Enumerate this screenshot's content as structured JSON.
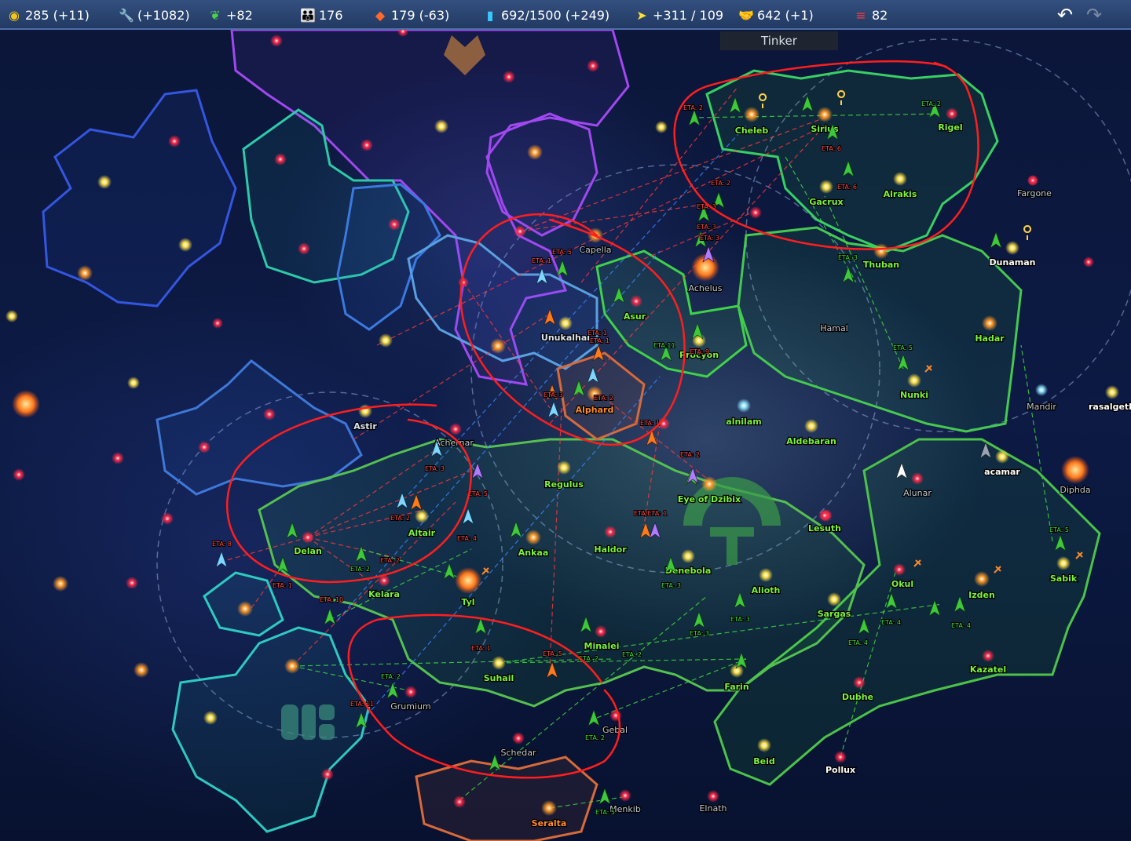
{
  "resources": [
    {
      "id": "credits",
      "icon": "credits-coin-icon",
      "label": "285 (+11)",
      "color": "#f5c518"
    },
    {
      "id": "industry",
      "icon": "wrench-icon",
      "label": "(+1082)",
      "color": "#ff8a1f"
    },
    {
      "id": "food",
      "icon": "wheat-icon",
      "label": "+82",
      "color": "#4cd24c"
    },
    {
      "id": "population",
      "icon": "people-icon",
      "label": "176",
      "color": "#ffffff"
    },
    {
      "id": "materials",
      "icon": "ore-icon",
      "label": "179 (-63)",
      "color": "#ff6a2a"
    },
    {
      "id": "research",
      "icon": "test-tube-icon",
      "label": "692/1500 (+249)",
      "color": "#37c8ff"
    },
    {
      "id": "fleet",
      "icon": "ship-icon",
      "label": "+311 / 109",
      "color": "#ffe033"
    },
    {
      "id": "diplomacy",
      "icon": "handshake-icon",
      "label": "642 (+1)",
      "color": "#b99cff"
    },
    {
      "id": "military",
      "icon": "flag-icon",
      "label": "82",
      "color": "#ff3b3b"
    }
  ],
  "tooltip": "Tinker",
  "colors": {
    "player": "#7cf23a",
    "enemy": "#ff8a2a",
    "annotation": "#ff2020",
    "neutral": "#dde6f2"
  },
  "systems": [
    {
      "name": "Cheleb",
      "owner": "player"
    },
    {
      "name": "Sirius",
      "owner": "player"
    },
    {
      "name": "Rigel",
      "owner": "player"
    },
    {
      "name": "Gacrux",
      "owner": "player"
    },
    {
      "name": "Alrakis",
      "owner": "player"
    },
    {
      "name": "Fargone",
      "owner": "neutral"
    },
    {
      "name": "Capella",
      "owner": "neutral"
    },
    {
      "name": "Achelus",
      "owner": "neutral"
    },
    {
      "name": "Thuban",
      "owner": "player"
    },
    {
      "name": "Dunaman",
      "owner": "white"
    },
    {
      "name": "Unukalhai",
      "owner": "neutral"
    },
    {
      "name": "Asur",
      "owner": "player"
    },
    {
      "name": "Hamal",
      "owner": "neutral"
    },
    {
      "name": "Procyon",
      "owner": "player"
    },
    {
      "name": "Hadar",
      "owner": "player"
    },
    {
      "name": "Nunki",
      "owner": "player"
    },
    {
      "name": "Alphard",
      "owner": "enemy"
    },
    {
      "name": "alnilam",
      "owner": "player"
    },
    {
      "name": "Aldebaran",
      "owner": "player"
    },
    {
      "name": "Mandir",
      "owner": "neutral"
    },
    {
      "name": "rasalgethi",
      "owner": "white"
    },
    {
      "name": "Astir",
      "owner": "neutral"
    },
    {
      "name": "Achernar",
      "owner": "neutral"
    },
    {
      "name": "Regulus",
      "owner": "player"
    },
    {
      "name": "Eye of Dzibix",
      "owner": "player"
    },
    {
      "name": "acamar",
      "owner": "white"
    },
    {
      "name": "Alunar",
      "owner": "neutral"
    },
    {
      "name": "Diphda",
      "owner": "neutral"
    },
    {
      "name": "Altair",
      "owner": "player"
    },
    {
      "name": "Lesuth",
      "owner": "player"
    },
    {
      "name": "Delan",
      "owner": "player"
    },
    {
      "name": "Ankaa",
      "owner": "player"
    },
    {
      "name": "Haldor",
      "owner": "player"
    },
    {
      "name": "Denebola",
      "owner": "player"
    },
    {
      "name": "Alioth",
      "owner": "player"
    },
    {
      "name": "Kelara",
      "owner": "player"
    },
    {
      "name": "Tyl",
      "owner": "player"
    },
    {
      "name": "Okul",
      "owner": "player"
    },
    {
      "name": "Izden",
      "owner": "player"
    },
    {
      "name": "Sabik",
      "owner": "player"
    },
    {
      "name": "Sargas",
      "owner": "player"
    },
    {
      "name": "Minalei",
      "owner": "player"
    },
    {
      "name": "Kazatel",
      "owner": "player"
    },
    {
      "name": "Suhail",
      "owner": "player"
    },
    {
      "name": "Farin",
      "owner": "player"
    },
    {
      "name": "Dubhe",
      "owner": "player"
    },
    {
      "name": "Grumium",
      "owner": "neutral"
    },
    {
      "name": "Gebal",
      "owner": "neutral"
    },
    {
      "name": "Beid",
      "owner": "player"
    },
    {
      "name": "Pollux",
      "owner": "white"
    },
    {
      "name": "Schedar",
      "owner": "neutral"
    },
    {
      "name": "Menkib",
      "owner": "neutral"
    },
    {
      "name": "Elnath",
      "owner": "neutral"
    },
    {
      "name": "Seralta",
      "owner": "enemy"
    }
  ],
  "eta_labels": [
    "ETA: 2",
    "ETA: 2",
    "ETA: 6",
    "ETA: 2",
    "ETA: 6",
    "ETA: 3",
    "ETA: 3",
    "ETA: 3",
    "ETA: 3",
    "ETA: 5",
    "ETA: 1",
    "ETA: 1",
    "ETA: 1",
    "ETA:11",
    "ETA: 9",
    "ETA: 5",
    "ETA: 3",
    "ETA: 2",
    "ETA: 1",
    "ETA: 2",
    "ETA: 3",
    "ETA: 5",
    "ETA: 2",
    "ETA: 4",
    "ETA: 8",
    "ETA: 2",
    "ETA: 2",
    "ETA: 1",
    "ETA/ETA: 1",
    "ETA: 3",
    "ETA: 3",
    "ETA: 3",
    "ETA: 10",
    "ETA: 5",
    "ETA: 4",
    "ETA: 4",
    "ETA: 1",
    "ETA: 5",
    "ETA: 2",
    "ETA: 2",
    "ETA: 4",
    "ETA: 2",
    "ETA: 11",
    "ETA: 2",
    "ETA: 5"
  ]
}
